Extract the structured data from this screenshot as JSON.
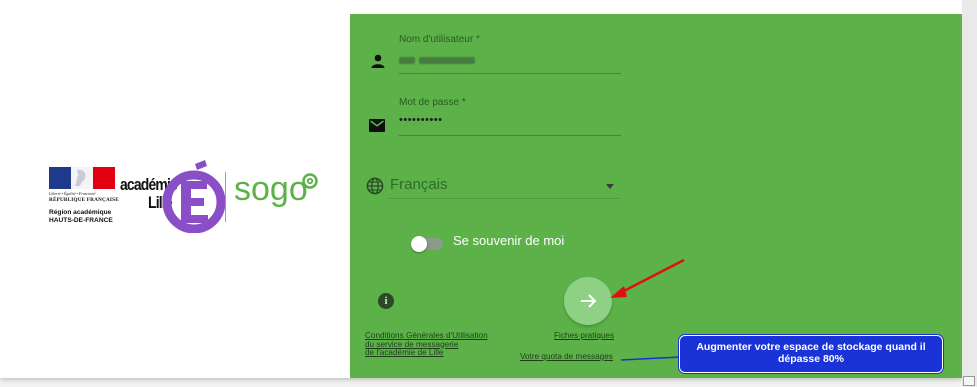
{
  "branding": {
    "flag_colors": [
      "#1e3a8a",
      "#f4f4f4",
      "#e1000f"
    ],
    "motto": "Liberté • Égalité • Fraternité",
    "republique": "RÉPUBLIQUE FRANÇAISE",
    "region_line1": "Région académique",
    "region_line2": "HAUTS-DE-FRANCE",
    "academie_line1": "académie",
    "academie_line2": "Lille",
    "e_letter": "É",
    "sogo_text": "sogo",
    "accent_purple": "#8a4fc7",
    "accent_green": "#5cb249"
  },
  "login": {
    "username_label": "Nom d'utilisateur *",
    "password_label": "Mot de passe *",
    "password_value": "••••••••••",
    "language_value": "Français",
    "remember_label": "Se souvenir de moi",
    "remember_checked": false,
    "submit_icon": "arrow-right-icon"
  },
  "footer": {
    "cgu_line1": "Conditions Générales d'Utilisation",
    "cgu_line2": "du service de messagerie",
    "cgu_line3": "de l'académie de Lille",
    "fiches_label": "Fiches pratiques",
    "quota_label": "Votre quota de messages"
  },
  "annotation": {
    "callout_line1": "Augmenter votre espace de stockage quand il",
    "callout_line2": "dépasse 80%",
    "arrow_color": "#e01010",
    "callout_color": "#1a33d6"
  }
}
